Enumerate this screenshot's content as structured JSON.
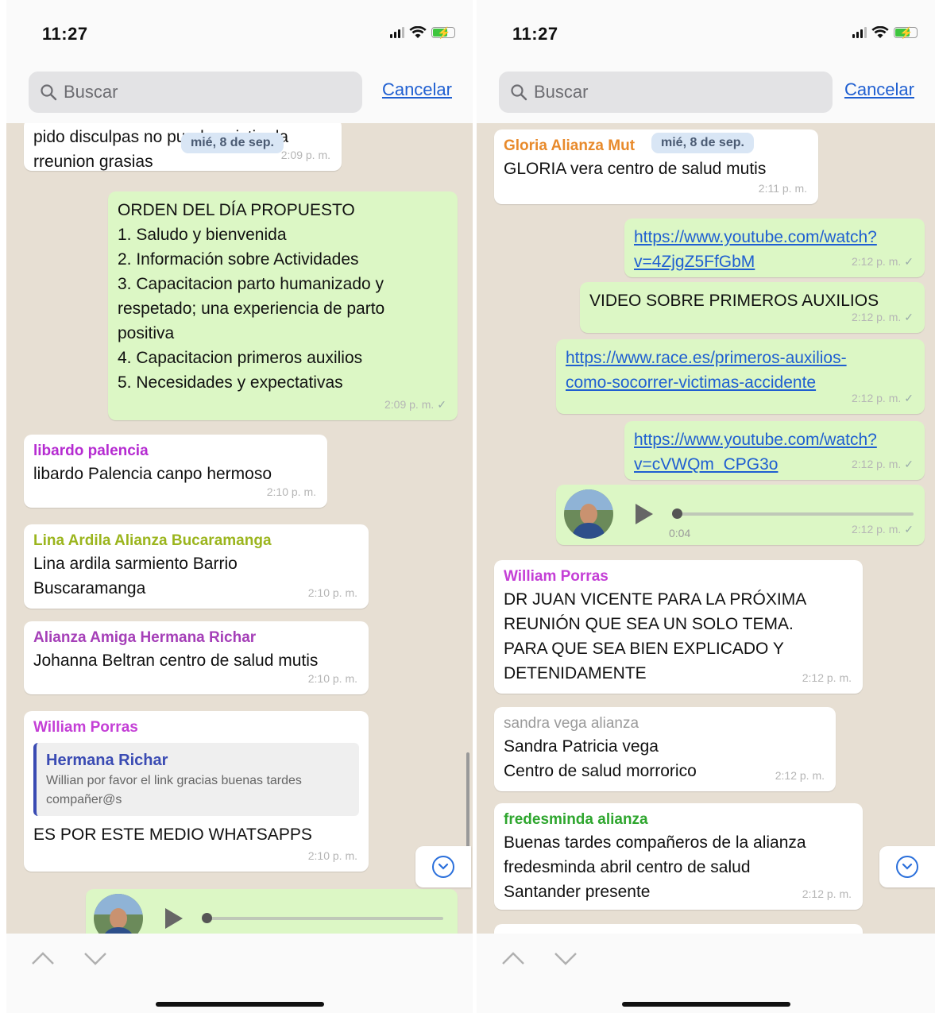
{
  "status": {
    "time": "11:27"
  },
  "search": {
    "placeholder": "Buscar",
    "cancel": "Cancelar"
  },
  "left": {
    "date_chip": "mié, 8 de sep.",
    "msg_apology": {
      "text_line1": "pido disculpas no puede asistir ala",
      "text_line2": "rreunion grasias",
      "time": "2:09 p. m."
    },
    "msg_orden": {
      "lines": [
        "ORDEN DEL DÍA PROPUESTO",
        "1. Saludo y bienvenida",
        "2. Información sobre Actividades",
        "3. Capacitacion parto humanizado y",
        "respetado; una experiencia de parto",
        "positiva",
        "4. Capacitacion primeros auxilios",
        "5. Necesidades y expectativas"
      ],
      "time": "2:09 p. m."
    },
    "msg_libardo": {
      "sender": "libardo palencia",
      "text": "libardo Palencia canpo hermoso",
      "time": "2:10 p. m."
    },
    "msg_lina": {
      "sender": "Lina Ardila Alianza Bucaramanga",
      "text_line1": "Lina ardila sarmiento Barrio",
      "text_line2": "Buscaramanga",
      "time": "2:10 p. m."
    },
    "msg_alianza": {
      "sender": "Alianza Amiga Hermana Richar",
      "text": "Johanna Beltran centro de salud mutis",
      "time": "2:10 p. m."
    },
    "msg_william": {
      "sender": "William Porras",
      "quote_name": "Hermana Richar",
      "quote_text": "Willian por favor el link gracias buenas tardes compañer@s",
      "text": "ES POR ESTE MEDIO WHATSAPPS",
      "time": "2:10 p. m."
    }
  },
  "right": {
    "date_chip": "mié, 8 de sep.",
    "msg_gloria": {
      "sender": "Gloria Alianza Mut",
      "text": "GLORIA vera centro de salud mutis",
      "time": "2:11 p. m."
    },
    "msg_link1": {
      "line1": "https://www.youtube.com/watch?",
      "line2": "v=4ZjgZ5FfGbM",
      "time": "2:12 p. m."
    },
    "msg_video": {
      "text": "VIDEO SOBRE PRIMEROS AUXILIOS",
      "time": "2:12 p. m."
    },
    "msg_link2": {
      "line1": "https://www.race.es/primeros-auxilios-",
      "line2": "como-socorrer-victimas-accidente",
      "time": "2:12 p. m."
    },
    "msg_link3": {
      "line1": "https://www.youtube.com/watch?",
      "line2": "v=cVWQm_CPG3o",
      "time": "2:12 p. m."
    },
    "msg_audio": {
      "duration": "0:04",
      "time": "2:12 p. m."
    },
    "msg_william": {
      "sender": "William Porras",
      "lines": [
        "DR JUAN VICENTE PARA LA PRÓXIMA",
        "REUNIÓN QUE SEA UN SOLO TEMA.",
        "PARA QUE SEA BIEN EXPLICADO Y",
        "DETENIDAMENTE"
      ],
      "time": "2:12 p. m."
    },
    "msg_sandra": {
      "sender": "sandra vega alianza",
      "text_line1": "Sandra Patricia vega",
      "text_line2": "Centro de salud morrorico",
      "time": "2:12 p. m."
    },
    "msg_fredes": {
      "sender": "fredesminda alianza",
      "lines": [
        "Buenas tardes compañeros de la alianza",
        "fredesminda abril centro de salud",
        "Santander presente"
      ],
      "time": "2:12 p. m."
    }
  },
  "colors": {
    "outgoing": "#dcf7c5",
    "incoming": "#ffffff",
    "link": "#1f5fd1",
    "chat_bg": "#e7dfd3"
  }
}
